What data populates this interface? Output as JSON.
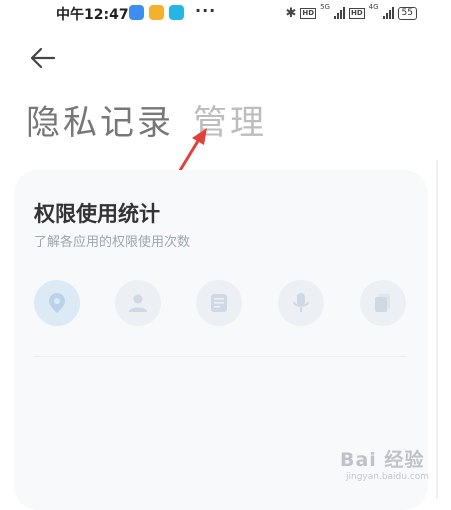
{
  "status_bar": {
    "time": "中午12:47",
    "more": "···",
    "net1": "5G",
    "net2": "4G",
    "hd1": "HD",
    "hd2": "HD",
    "battery": "55"
  },
  "header": {
    "title": "隐私记录",
    "manage": "管理"
  },
  "card": {
    "title": "权限使用统计",
    "subtitle": "了解各应用的权限使用次数",
    "icons": [
      "location-icon",
      "contacts-icon",
      "sms-icon",
      "microphone-icon",
      "storage-icon"
    ]
  },
  "watermark": {
    "main": "Bai 经验",
    "sub": "jingyan.baidu.com"
  },
  "colors": {
    "arrow": "#e0413b",
    "icon_fill": "#cfd9e3",
    "active_bg": "#dceaf6"
  }
}
